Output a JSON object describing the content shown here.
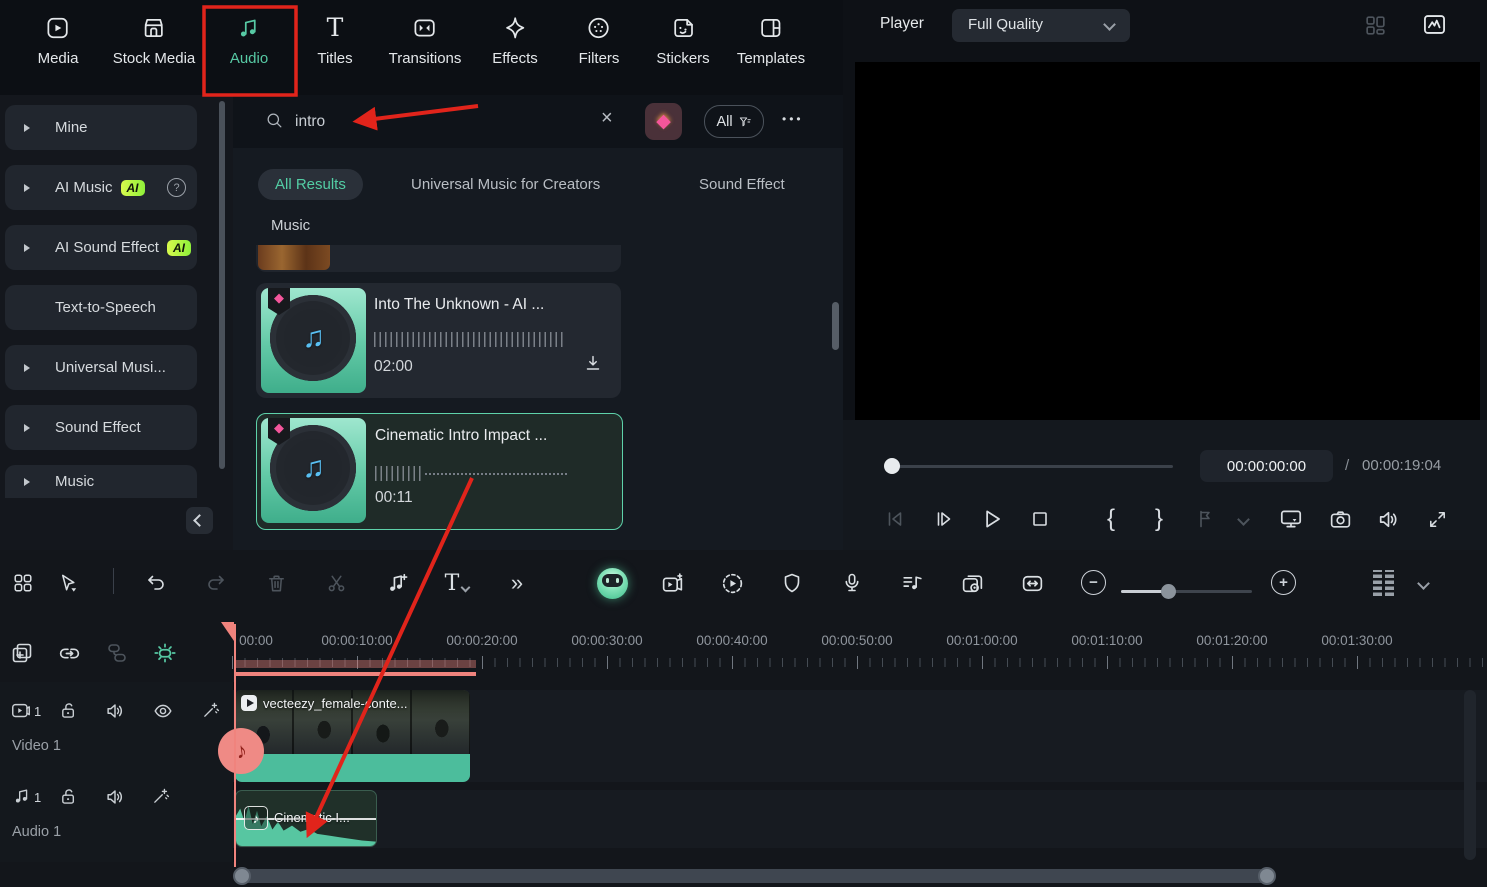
{
  "colors": {
    "accent": "#57c9a4",
    "annotation_red": "#e1241b",
    "ai_badge_green": "#a7f23c",
    "playhead_salmon": "#f0837d"
  },
  "top_nav": {
    "items": [
      {
        "label": "Media",
        "icon": "media-icon"
      },
      {
        "label": "Stock Media",
        "icon": "stock-media-icon"
      },
      {
        "label": "Audio",
        "icon": "audio-icon",
        "active": true,
        "annotated": "red-box"
      },
      {
        "label": "Titles",
        "icon": "titles-icon"
      },
      {
        "label": "Transitions",
        "icon": "transitions-icon"
      },
      {
        "label": "Effects",
        "icon": "effects-icon"
      },
      {
        "label": "Filters",
        "icon": "filters-icon"
      },
      {
        "label": "Stickers",
        "icon": "stickers-icon"
      },
      {
        "label": "Templates",
        "icon": "templates-icon"
      }
    ]
  },
  "sidebar": {
    "items": [
      {
        "label": "Mine",
        "chevron": true
      },
      {
        "label": "AI Music",
        "chevron": true,
        "badge": "AI",
        "help": "?"
      },
      {
        "label": "AI Sound Effect",
        "chevron": true,
        "badge": "AI"
      },
      {
        "label": "Text-to-Speech"
      },
      {
        "label": "Universal Musi...",
        "chevron": true
      },
      {
        "label": "Sound Effect",
        "chevron": true
      },
      {
        "label": "Music",
        "chevron": true
      }
    ]
  },
  "search": {
    "query": "intro",
    "clear_glyph": "×",
    "filter_label": "All",
    "more_glyph": "•••",
    "gem_glyph": "◆"
  },
  "results": {
    "tabs": [
      {
        "label": "All Results",
        "active": true
      },
      {
        "label": "Universal Music for Creators"
      },
      {
        "label": "Sound Effect"
      }
    ],
    "section_label": "Music",
    "items": [
      {
        "title": "Into The Unknown - AI ...",
        "duration": "02:00",
        "premium": true,
        "downloadable": true
      },
      {
        "title": "Cinematic Intro Impact ...",
        "duration": "00:11",
        "premium": true,
        "selected": true
      }
    ]
  },
  "player": {
    "title": "Player",
    "quality": "Full Quality",
    "current_time": "00:00:00:00",
    "separator": "/",
    "total_time": "00:00:19:04"
  },
  "timeline": {
    "ruler_labels": [
      "00:00",
      "00:00:10:00",
      "00:00:20:00",
      "00:00:30:00",
      "00:00:40:00",
      "00:00:50:00",
      "00:01:00:00",
      "00:01:10:00",
      "00:01:20:00",
      "00:01:30:00"
    ],
    "tracks": {
      "video": {
        "number": "1",
        "label": "Video 1",
        "clip_title": "vecteezy_female-conte..."
      },
      "audio": {
        "number": "1",
        "label": "Audio 1",
        "clip_title": "Cinematic I..."
      }
    }
  }
}
